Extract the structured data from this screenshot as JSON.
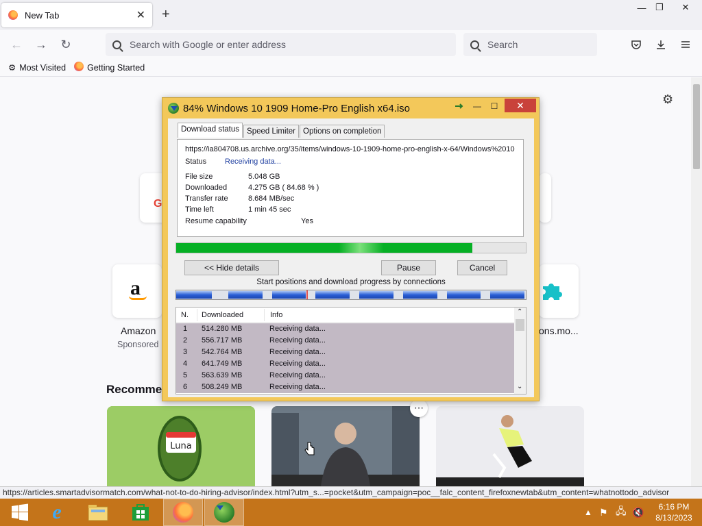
{
  "browser": {
    "tab_title": "New Tab",
    "tab_close": "✕",
    "new_tab": "+",
    "window_controls": {
      "minimize": "—",
      "restore": "❐",
      "close": "✕"
    },
    "url_placeholder": "Search with Google or enter address",
    "search_placeholder": "Search",
    "bookmarks": [
      "Most Visited",
      "Getting Started"
    ]
  },
  "newtab": {
    "shortcuts": [
      {
        "label": "Amazon",
        "sub": "Sponsored"
      },
      {
        "label": "ons.mo..."
      }
    ],
    "recommended_title": "Recommen",
    "more_button": "⋯"
  },
  "status_url": "https://articles.smartadvisormatch.com/what-not-to-do-hiring-advisor/index.html?utm_s...=pocket&utm_campaign=poc__falc_content_firefoxnewtab&utm_content=whatnottodo_advisor",
  "idm": {
    "title": "84% Windows 10 1909 Home-Pro English x64.iso",
    "tabs": [
      "Download status",
      "Speed Limiter",
      "Options on completion"
    ],
    "url": "https://ia804708.us.archive.org/35/items/windows-10-1909-home-pro-english-x-64/Windows%2010",
    "status_label": "Status",
    "status_value": "Receiving data...",
    "file_size_label": "File size",
    "file_size_value": "5.048  GB",
    "downloaded_label": "Downloaded",
    "downloaded_value": "4.275  GB  ( 84.68 % )",
    "rate_label": "Transfer rate",
    "rate_value": "8.684  MB/sec",
    "time_label": "Time left",
    "time_value": "1 min 45 sec",
    "resume_label": "Resume capability",
    "resume_value": "Yes",
    "progress": 0.8468,
    "buttons": {
      "hide": "<< Hide details",
      "pause": "Pause",
      "cancel": "Cancel"
    },
    "connections_label": "Start positions and download progress by connections",
    "columns": [
      "N.",
      "Downloaded",
      "Info"
    ],
    "connections": [
      {
        "n": "1",
        "downloaded": "514.280  MB",
        "info": "Receiving data..."
      },
      {
        "n": "2",
        "downloaded": "556.717  MB",
        "info": "Receiving data..."
      },
      {
        "n": "3",
        "downloaded": "542.764  MB",
        "info": "Receiving data..."
      },
      {
        "n": "4",
        "downloaded": "641.749  MB",
        "info": "Receiving data..."
      },
      {
        "n": "5",
        "downloaded": "563.639  MB",
        "info": "Receiving data..."
      },
      {
        "n": "6",
        "downloaded": "508.249  MB",
        "info": "Receiving data..."
      }
    ],
    "accent": "#06b025"
  },
  "taskbar": {
    "time": "6:16 PM",
    "date": "8/13/2023",
    "color": "#c4741a"
  }
}
